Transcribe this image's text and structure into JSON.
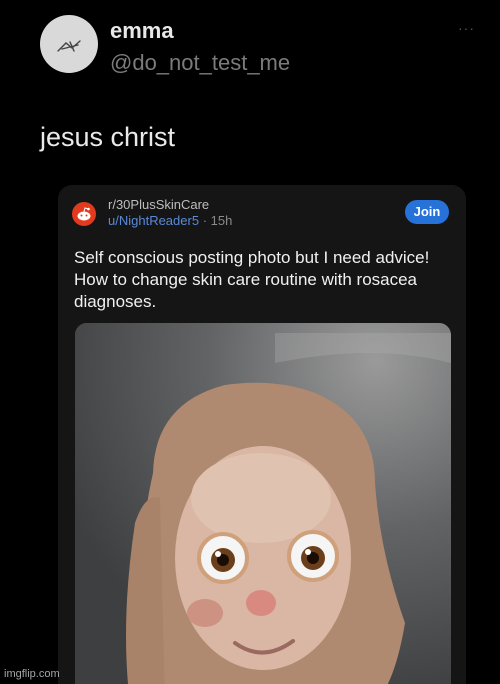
{
  "tweet": {
    "display_name": "emma",
    "handle": "@do_not_test_me",
    "text": "jesus christ",
    "more_label": "···"
  },
  "embedded_post": {
    "subreddit": "r/30PlusSkinCare",
    "author": "u/NightReader5",
    "separator": "·",
    "age": "15h",
    "join_label": "Join",
    "title": "Self conscious posting photo but I need advice! How to change skin care routine with rosacea diagnoses.",
    "icons": {
      "subreddit": "reddit-alien-icon"
    }
  },
  "watermark": "imgflip.com",
  "colors": {
    "background": "#000000",
    "card": "#151515",
    "join_button": "#2672d8",
    "username_link": "#5a8ad8",
    "subreddit_icon": "#e13a1e"
  }
}
